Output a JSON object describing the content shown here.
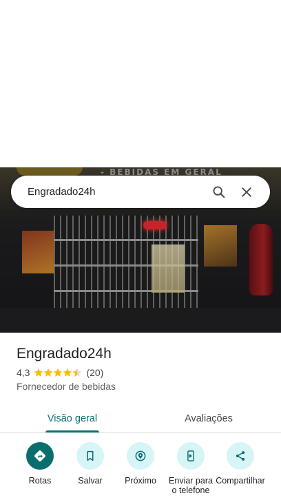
{
  "search": {
    "query": "Engradado24h"
  },
  "photo": {
    "sign_text": "- BEBIDAS EM GERAL"
  },
  "place": {
    "name": "Engradado24h",
    "rating": "4,3",
    "rating_value": 4.3,
    "review_count": "(20)",
    "category": "Fornecedor de bebidas"
  },
  "tabs": [
    {
      "label": "Visão geral",
      "selected": true
    },
    {
      "label": "Avaliações",
      "selected": false
    }
  ],
  "actions": [
    {
      "label": "Rotas",
      "icon": "directions-icon"
    },
    {
      "label": "Salvar",
      "icon": "bookmark-icon"
    },
    {
      "label": "Próximo",
      "icon": "nearby-icon"
    },
    {
      "label": "Enviar para o telefone",
      "icon": "send-to-phone-icon"
    },
    {
      "label": "Compartilhar",
      "icon": "share-icon"
    }
  ],
  "colors": {
    "accent": "#0b6e6e",
    "chip": "#d7f4f7",
    "star": "#fbbc04"
  }
}
